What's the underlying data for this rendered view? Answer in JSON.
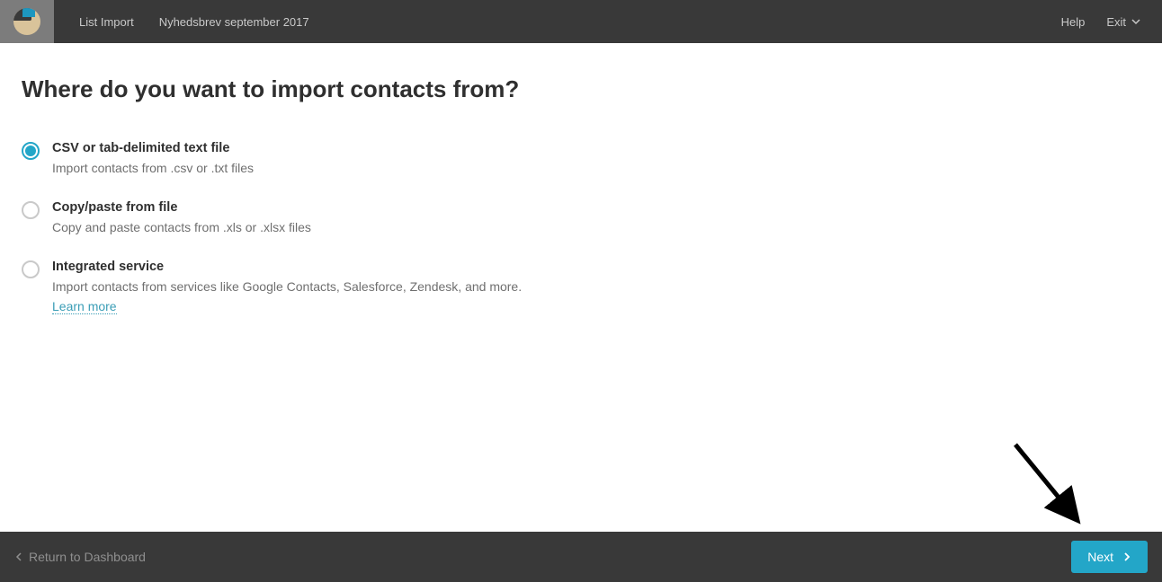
{
  "header": {
    "breadcrumb1": "List Import",
    "breadcrumb2": "Nyhedsbrev september 2017",
    "help": "Help",
    "exit": "Exit"
  },
  "main": {
    "title": "Where do you want to import contacts from?",
    "options": [
      {
        "label": "CSV or tab-delimited text file",
        "desc": "Import contacts from .csv or .txt files",
        "checked": true
      },
      {
        "label": "Copy/paste from file",
        "desc": "Copy and paste contacts from .xls or .xlsx files",
        "checked": false
      },
      {
        "label": "Integrated service",
        "desc": "Import contacts from services like Google Contacts, Salesforce, Zendesk, and more.",
        "learn_more": "Learn more",
        "checked": false
      }
    ]
  },
  "footer": {
    "return": "Return to Dashboard",
    "next": "Next"
  }
}
